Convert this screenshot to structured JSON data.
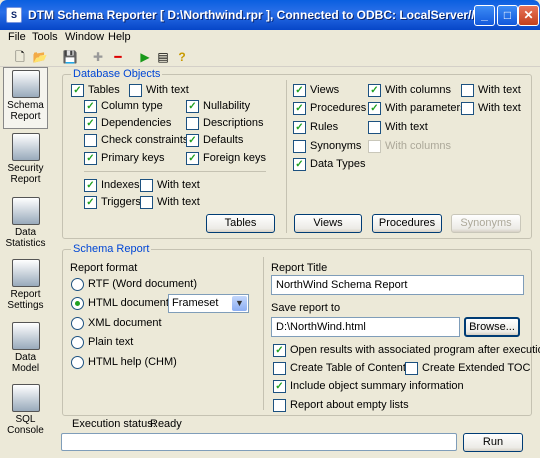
{
  "window": {
    "title": "DTM Schema Reporter [ D:\\Northwind.rpr ], Connected to ODBC: LocalServer//d...",
    "minimize": "_",
    "maximize": "□",
    "close": "✕"
  },
  "menu": [
    "File",
    "Tools",
    "Window",
    "Help"
  ],
  "toolbar": {
    "new_icon": "new-doc-icon",
    "open_icon": "folder-icon",
    "save_icon": "save-icon",
    "add_icon": "plus-icon",
    "remove_icon": "minus-icon",
    "run_icon": "run-icon",
    "list_icon": "list-icon",
    "help_icon": "question-icon"
  },
  "sidebar": [
    {
      "label": "Schema Report"
    },
    {
      "label": "Security Report"
    },
    {
      "label": "Data Statistics"
    },
    {
      "label": "Report Settings"
    },
    {
      "label": "Data Model"
    },
    {
      "label": "SQL Console"
    }
  ],
  "database_objects": {
    "title": "Database Objects",
    "tables": "Tables",
    "tables_with_text": "With text",
    "column_type": "Column type",
    "nullability": "Nullability",
    "dependencies": "Dependencies",
    "descriptions": "Descriptions",
    "check_constraints": "Check constraints",
    "defaults": "Defaults",
    "primary_keys": "Primary keys",
    "foreign_keys": "Foreign keys",
    "indexes": "Indexes",
    "indexes_with_text": "With text",
    "triggers": "Triggers",
    "triggers_with_text": "With text",
    "tables_button": "Tables",
    "views": "Views",
    "views_with_columns": "With columns",
    "views_with_text": "With text",
    "procedures": "Procedures",
    "procedures_with_parameters": "With parameters",
    "procedures_with_text": "With text",
    "rules": "Rules",
    "rules_with_text": "With text",
    "synonyms": "Synonyms",
    "synonyms_with_columns": "With columns",
    "data_types": "Data Types",
    "views_button": "Views",
    "procedures_button": "Procedures",
    "synonyms_button": "Synonyms"
  },
  "schema_report": {
    "title": "Schema Report",
    "report_format_label": "Report format",
    "formats": [
      "RTF (Word document)",
      "HTML document",
      "XML document",
      "Plain text",
      "HTML help (CHM)"
    ],
    "html_style": "Frameset",
    "report_title_label": "Report Title",
    "report_title": "NorthWind Schema Report",
    "save_to_label": "Save report to",
    "save_to": "D:\\NorthWind.html",
    "browse": "Browse...",
    "open_results": "Open results with associated program after execution",
    "create_toc": "Create Table of Contents",
    "create_ext_toc": "Create Extended TOC",
    "include_summary": "Include object summary information",
    "report_empty": "Report about empty lists"
  },
  "status": {
    "label": "Execution status:",
    "value": "Ready",
    "run": "Run"
  }
}
